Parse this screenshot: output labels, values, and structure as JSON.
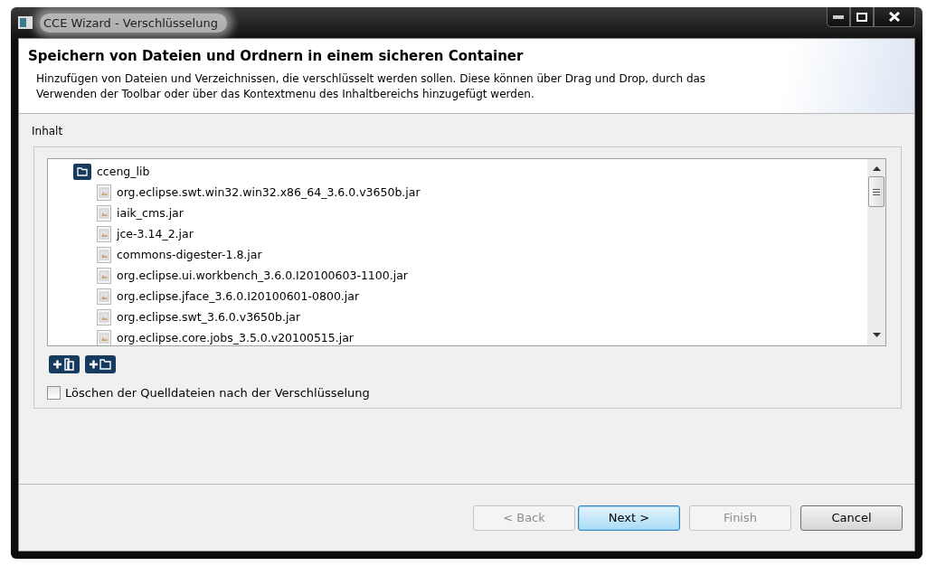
{
  "window": {
    "title": "CCE Wizard - Verschlüsselung"
  },
  "header": {
    "title": "Speichern von Dateien und Ordnern in einem sicheren Container",
    "description": "Hinzufügen von Dateien und Verzeichnissen, die verschlüsselt werden sollen. Diese können über Drag und Drop, durch das Verwenden der Toolbar oder über das Kontextmenu des Inhaltbereichs hinzugefügt werden."
  },
  "content": {
    "label": "Inhalt",
    "tree": [
      {
        "kind": "folder",
        "label": "cceng_lib",
        "children": [
          {
            "kind": "file",
            "label": "org.eclipse.swt.win32.win32.x86_64_3.6.0.v3650b.jar"
          },
          {
            "kind": "file",
            "label": "iaik_cms.jar"
          },
          {
            "kind": "file",
            "label": "jce-3.14_2.jar"
          },
          {
            "kind": "file",
            "label": "commons-digester-1.8.jar"
          },
          {
            "kind": "file",
            "label": "org.eclipse.ui.workbench_3.6.0.I20100603-1100.jar"
          },
          {
            "kind": "file",
            "label": "org.eclipse.jface_3.6.0.I20100601-0800.jar"
          },
          {
            "kind": "file",
            "label": "org.eclipse.swt_3.6.0.v3650b.jar"
          },
          {
            "kind": "file",
            "label": "org.eclipse.core.jobs_3.5.0.v20100515.jar"
          }
        ]
      }
    ],
    "toolbar": [
      {
        "kind": "add-file"
      },
      {
        "kind": "add-folder"
      }
    ],
    "delete_sources": {
      "label": "Löschen der Quelldateien nach der Verschlüsselung",
      "checked": false
    }
  },
  "buttons": [
    {
      "label": "< Back",
      "disabled": true,
      "default": false
    },
    {
      "label": "Next >",
      "disabled": false,
      "default": true
    },
    {
      "label": "Finish",
      "disabled": true,
      "default": false
    },
    {
      "label": "Cancel",
      "disabled": false,
      "default": false
    }
  ]
}
